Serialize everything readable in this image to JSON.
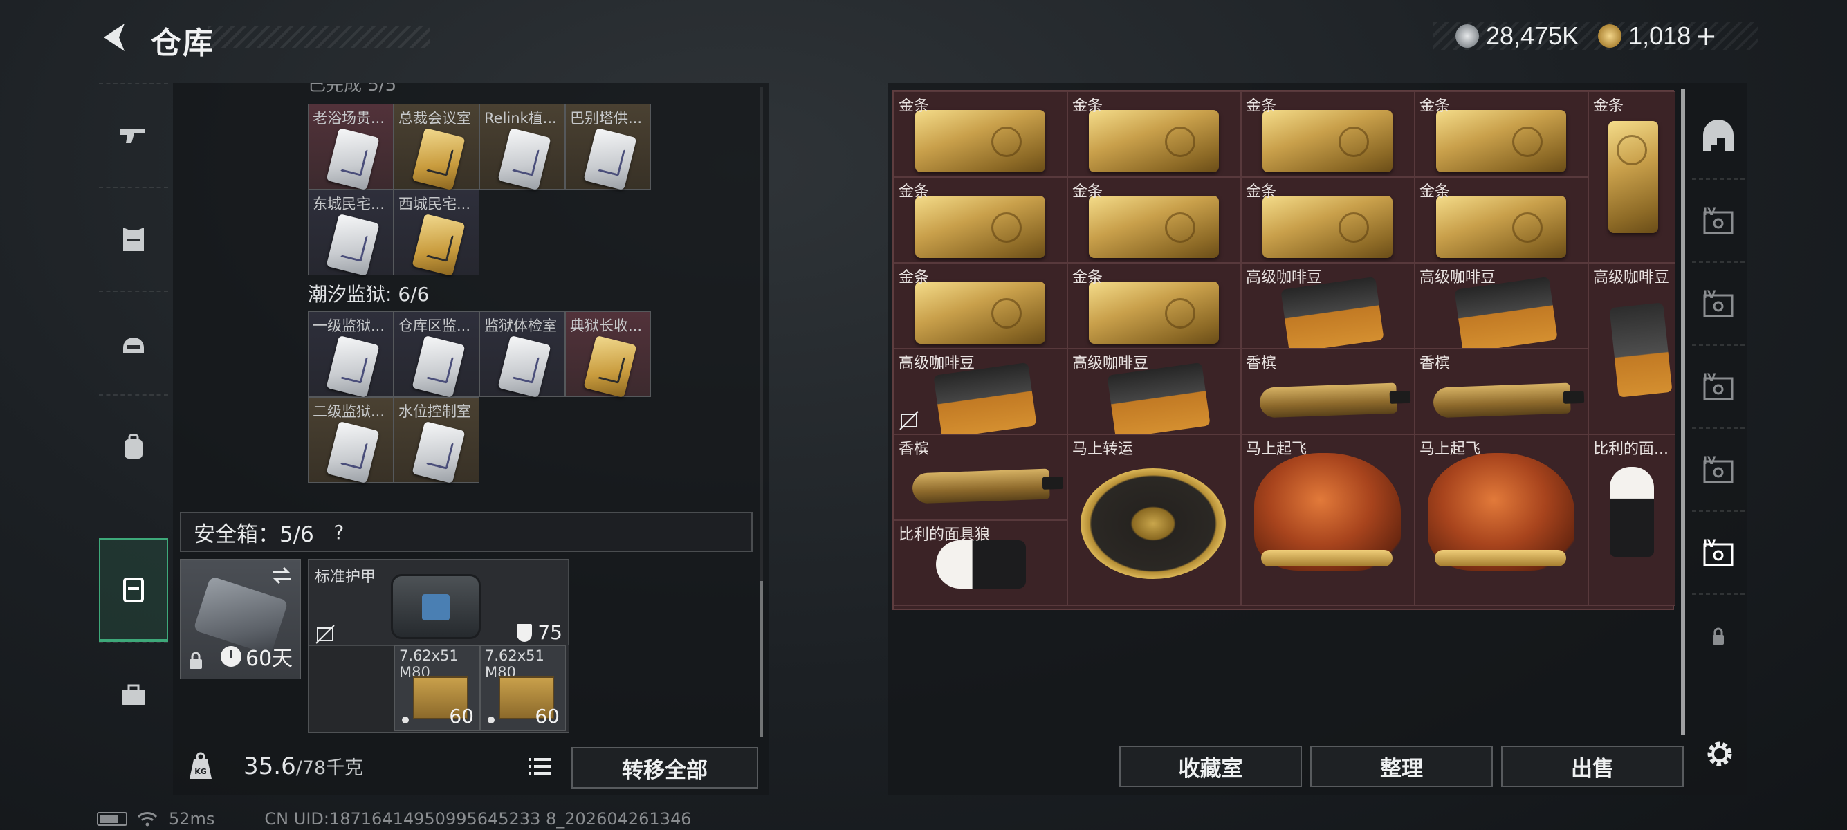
{
  "header": {
    "title": "仓库",
    "currency_silver": "28,475K",
    "currency_gold": "1,018",
    "plus_label": "+"
  },
  "left_nav": {
    "items": [
      {
        "name": "weapons",
        "icon": "gun-icon"
      },
      {
        "name": "armor",
        "icon": "vest-icon"
      },
      {
        "name": "helmet",
        "icon": "helmet-icon"
      },
      {
        "name": "backpack",
        "icon": "backpack-icon"
      },
      {
        "name": "containers",
        "icon": "safebox-icon",
        "active": true
      },
      {
        "name": "tools",
        "icon": "toolbox-icon"
      }
    ]
  },
  "left_panel": {
    "cut_header": "已完成 5/5",
    "top_cards_row1": [
      "老浴场贵...",
      "总裁会议室",
      "Relink植...",
      "巴别塔供..."
    ],
    "top_cards_row2": [
      "东城民宅...",
      "西城民宅..."
    ],
    "section2_title": "潮汐监狱: 6/6",
    "prison_row1": [
      "一级监狱...",
      "仓库区监...",
      "监狱体检室",
      "典狱长收..."
    ],
    "prison_row2": [
      "二级监狱...",
      "水位控制室"
    ]
  },
  "safe_box": {
    "label": "安全箱：5/6",
    "help": "?",
    "case_timer": "60天",
    "armor_name": "标准护甲",
    "armor_durability": "75",
    "ammo": [
      {
        "name": "7.62x51 M80",
        "count": "60"
      },
      {
        "name": "7.62x51 M80",
        "count": "60"
      }
    ]
  },
  "footer_left": {
    "weight_current": "35.6",
    "weight_max": "/78千克",
    "transfer_all": "转移全部"
  },
  "stash": {
    "items": [
      {
        "name": "金条",
        "type": "gold-bar"
      },
      {
        "name": "金条",
        "type": "gold-bar"
      },
      {
        "name": "金条",
        "type": "gold-bar"
      },
      {
        "name": "金条",
        "type": "gold-bar"
      },
      {
        "name": "金条",
        "type": "gold-bar-vertical"
      },
      {
        "name": "金条",
        "type": "gold-bar"
      },
      {
        "name": "金条",
        "type": "gold-bar"
      },
      {
        "name": "金条",
        "type": "gold-bar"
      },
      {
        "name": "金条",
        "type": "gold-bar"
      },
      {
        "name": "金条",
        "type": "gold-bar"
      },
      {
        "name": "金条",
        "type": "gold-bar"
      },
      {
        "name": "高级咖啡豆",
        "type": "coffee"
      },
      {
        "name": "高级咖啡豆",
        "type": "coffee"
      },
      {
        "name": "高级咖啡豆",
        "type": "coffee-vertical"
      },
      {
        "name": "高级咖啡豆",
        "type": "coffee"
      },
      {
        "name": "高级咖啡豆",
        "type": "coffee"
      },
      {
        "name": "香槟",
        "type": "champagne"
      },
      {
        "name": "香槟",
        "type": "champagne"
      },
      {
        "name": "香槟",
        "type": "champagne"
      },
      {
        "name": "马上转运",
        "type": "wheel"
      },
      {
        "name": "马上起飞",
        "type": "horse"
      },
      {
        "name": "马上起飞",
        "type": "horse"
      },
      {
        "name": "比利的面...",
        "type": "doll"
      },
      {
        "name": "比利的面具狼",
        "type": "doll-lying"
      }
    ]
  },
  "right_tabs": [
    "home-tab",
    "IV",
    "IV",
    "IV",
    "IV",
    "IV",
    "lock-tab"
  ],
  "actions": {
    "collection": "收藏室",
    "sort": "整理",
    "sell": "出售"
  },
  "status_bar": {
    "ping": "52ms",
    "uid": "CN UID:18716414950995645233 8_202604261346"
  },
  "colors": {
    "accent_green": "#3ea97a",
    "stash_bg": "#3b2326",
    "gold": "#c9a04b"
  }
}
